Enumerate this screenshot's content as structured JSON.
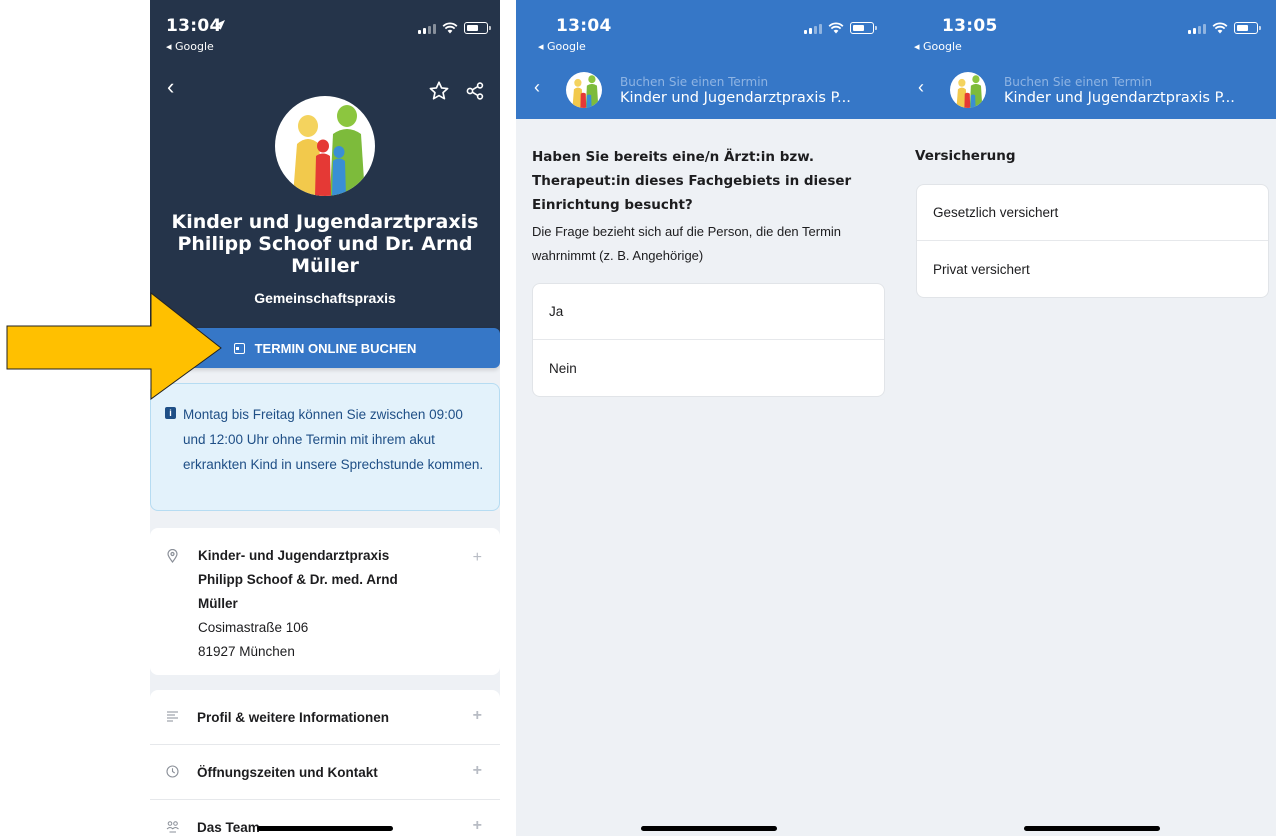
{
  "colors": {
    "hero_bg": "#25344a",
    "header_blue": "#3677c7",
    "info_bg": "#e3f2fb",
    "info_text": "#1f4f86",
    "arrow": "#ffc000"
  },
  "screen1": {
    "time": "13:04",
    "back_app": "◂ Google",
    "title": "Kinder und Jugendarztpraxis Philipp Schoof und Dr. Arnd Müller",
    "subtitle": "Gemeinschaftspraxis",
    "book_button": "TERMIN ONLINE BUCHEN",
    "info_text": "Montag bis Freitag können Sie zwischen 09:00 und 12:00 Uhr ohne Termin mit ihrem akut erkrankten Kind in unsere Sprechstunde kommen.",
    "address": {
      "name": "Kinder- und Jugendarztpraxis Philipp Schoof & Dr. med. Arnd Müller",
      "street": "Cosimastraße 106",
      "city": "81927 München"
    },
    "menu": [
      {
        "label": "Profil & weitere Informationen"
      },
      {
        "label": "Öffnungszeiten und Kontakt"
      },
      {
        "label": "Das Team"
      }
    ]
  },
  "screen2": {
    "time": "13:04",
    "back_app": "◂ Google",
    "header_sup": "Buchen Sie einen Termin",
    "header_title": "Kinder und Jugendarztpraxis P...",
    "question": "Haben Sie bereits eine/n Ärzt:in bzw. Therapeut:in dieses Fachgebiets in dieser Einrichtung besucht?",
    "hint": "Die Frage bezieht sich auf die Person, die den Termin wahrnimmt (z. B. Angehörige)",
    "options": [
      "Ja",
      "Nein"
    ]
  },
  "screen3": {
    "time": "13:05",
    "back_app": "◂ Google",
    "header_sup": "Buchen Sie einen Termin",
    "header_title": "Kinder und Jugendarztpraxis P...",
    "section": "Versicherung",
    "options": [
      "Gesetzlich versichert",
      "Privat versichert"
    ]
  }
}
